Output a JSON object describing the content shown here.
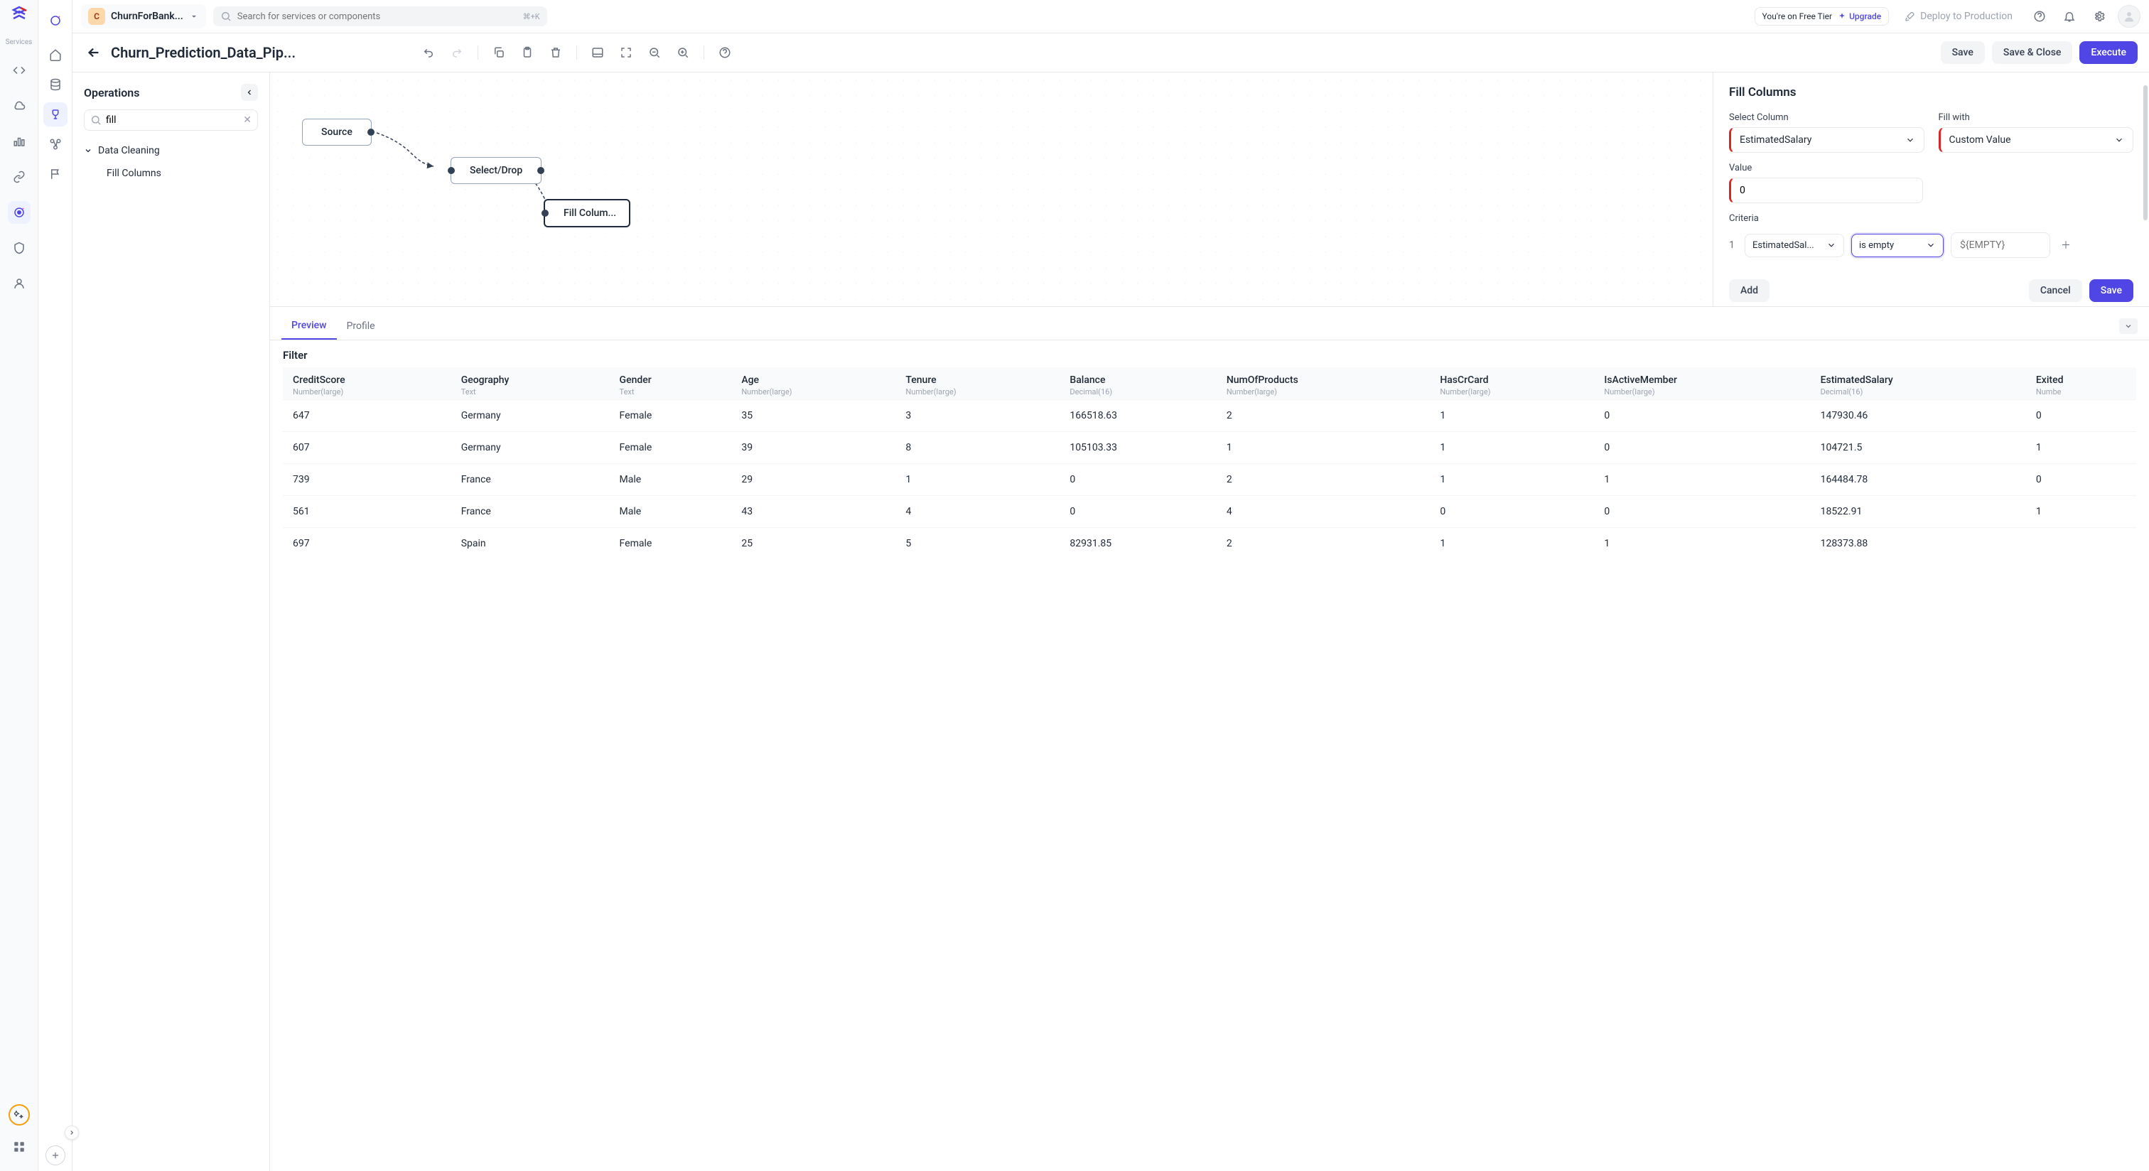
{
  "org": {
    "badge": "C",
    "name": "ChurnForBank..."
  },
  "search": {
    "placeholder": "Search for services or components",
    "shortcut": "⌘+K"
  },
  "tier": {
    "text": "You're on Free Tier",
    "action": "Upgrade"
  },
  "deploy": "Deploy to Production",
  "toolbar": {
    "title": "Churn_Prediction_Data_Pip...",
    "save": "Save",
    "save_close": "Save & Close",
    "execute": "Execute"
  },
  "rail_label": "Services",
  "ops_panel": {
    "title": "Operations",
    "search_value": "fill",
    "group": "Data Cleaning",
    "item": "Fill Columns"
  },
  "nodes": {
    "source": "Source",
    "select_drop": "Select/Drop",
    "fill_columns": "Fill Colum..."
  },
  "config": {
    "title": "Fill Columns",
    "select_column_label": "Select Column",
    "select_column_value": "EstimatedSalary",
    "fill_with_label": "Fill with",
    "fill_with_value": "Custom Value",
    "value_label": "Value",
    "value": "0",
    "criteria_label": "Criteria",
    "criteria_index": "1",
    "criteria_column": "EstimatedSal...",
    "criteria_op": "is empty",
    "criteria_placeholder": "${EMPTY}",
    "add": "Add",
    "cancel": "Cancel",
    "save": "Save"
  },
  "preview": {
    "tab_preview": "Preview",
    "tab_profile": "Profile",
    "filter": "Filter",
    "columns": [
      {
        "name": "CreditScore",
        "type": "Number(large)"
      },
      {
        "name": "Geography",
        "type": "Text"
      },
      {
        "name": "Gender",
        "type": "Text"
      },
      {
        "name": "Age",
        "type": "Number(large)"
      },
      {
        "name": "Tenure",
        "type": "Number(large)"
      },
      {
        "name": "Balance",
        "type": "Decimal(16)"
      },
      {
        "name": "NumOfProducts",
        "type": "Number(large)"
      },
      {
        "name": "HasCrCard",
        "type": "Number(large)"
      },
      {
        "name": "IsActiveMember",
        "type": "Number(large)"
      },
      {
        "name": "EstimatedSalary",
        "type": "Decimal(16)"
      },
      {
        "name": "Exited",
        "type": "Numbe"
      }
    ],
    "rows": [
      [
        "647",
        "Germany",
        "Female",
        "35",
        "3",
        "166518.63",
        "2",
        "1",
        "0",
        "147930.46",
        "0"
      ],
      [
        "607",
        "Germany",
        "Female",
        "39",
        "8",
        "105103.33",
        "1",
        "1",
        "0",
        "104721.5",
        "1"
      ],
      [
        "739",
        "France",
        "Male",
        "29",
        "1",
        "0",
        "2",
        "1",
        "1",
        "164484.78",
        "0"
      ],
      [
        "561",
        "France",
        "Male",
        "43",
        "4",
        "0",
        "4",
        "0",
        "0",
        "18522.91",
        "1"
      ],
      [
        "697",
        "Spain",
        "Female",
        "25",
        "5",
        "82931.85",
        "2",
        "1",
        "1",
        "128373.88",
        ""
      ]
    ]
  }
}
